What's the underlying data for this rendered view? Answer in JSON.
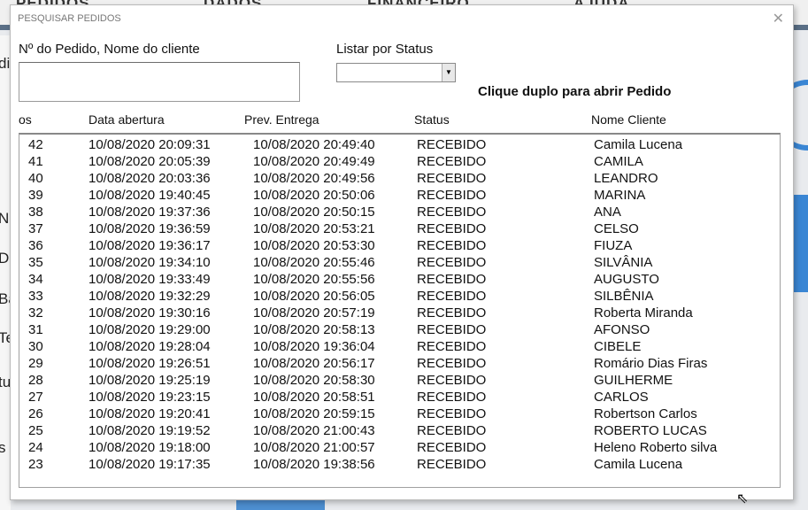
{
  "background": {
    "menu": [
      "PEDIDOS",
      "DADOS",
      "FINANCEIRO",
      "AJUDA"
    ],
    "left_fragments": [
      "di",
      "N",
      "D",
      "Ba",
      "Te",
      "tu",
      "s"
    ]
  },
  "dialog": {
    "title": "PESQUISAR PEDIDOS",
    "close": "✕",
    "search_label": "Nº do Pedido, Nome do cliente",
    "search_value": "",
    "status_label": "Listar por Status",
    "status_value": "",
    "hint": "Clique duplo para abrir Pedido",
    "columns": [
      "os",
      "Data abertura",
      "Prev. Entrega",
      "Status",
      "Nome Cliente"
    ],
    "rows": [
      [
        "42",
        "10/08/2020 20:09:31",
        "10/08/2020 20:49:40",
        "RECEBIDO",
        "Camila Lucena"
      ],
      [
        "41",
        "10/08/2020 20:05:39",
        "10/08/2020 20:49:49",
        "RECEBIDO",
        "CAMILA"
      ],
      [
        "40",
        "10/08/2020 20:03:36",
        "10/08/2020 20:49:56",
        "RECEBIDO",
        "LEANDRO"
      ],
      [
        "39",
        "10/08/2020 19:40:45",
        "10/08/2020 20:50:06",
        "RECEBIDO",
        "MARINA"
      ],
      [
        "38",
        "10/08/2020 19:37:36",
        "10/08/2020 20:50:15",
        "RECEBIDO",
        "ANA"
      ],
      [
        "37",
        "10/08/2020 19:36:59",
        "10/08/2020 20:53:21",
        "RECEBIDO",
        "CELSO"
      ],
      [
        "36",
        "10/08/2020 19:36:17",
        "10/08/2020 20:53:30",
        "RECEBIDO",
        "FIUZA"
      ],
      [
        "35",
        "10/08/2020 19:34:10",
        "10/08/2020 20:55:46",
        "RECEBIDO",
        "SILVÂNIA"
      ],
      [
        "34",
        "10/08/2020 19:33:49",
        "10/08/2020 20:55:56",
        "RECEBIDO",
        "AUGUSTO"
      ],
      [
        "33",
        "10/08/2020 19:32:29",
        "10/08/2020 20:56:05",
        "RECEBIDO",
        "SILBÊNIA"
      ],
      [
        "32",
        "10/08/2020 19:30:16",
        "10/08/2020 20:57:19",
        "RECEBIDO",
        "Roberta Miranda"
      ],
      [
        "31",
        "10/08/2020 19:29:00",
        "10/08/2020 20:58:13",
        "RECEBIDO",
        "AFONSO"
      ],
      [
        "30",
        "10/08/2020 19:28:04",
        "10/08/2020 19:36:04",
        "RECEBIDO",
        "CIBELE"
      ],
      [
        "29",
        "10/08/2020 19:26:51",
        "10/08/2020 20:56:17",
        "RECEBIDO",
        "Romário Dias Firas"
      ],
      [
        "28",
        "10/08/2020 19:25:19",
        "10/08/2020 20:58:30",
        "RECEBIDO",
        "GUILHERME"
      ],
      [
        "27",
        "10/08/2020 19:23:15",
        "10/08/2020 20:58:51",
        "RECEBIDO",
        "CARLOS"
      ],
      [
        "26",
        "10/08/2020 19:20:41",
        "10/08/2020 20:59:15",
        "RECEBIDO",
        "Robertson Carlos"
      ],
      [
        "25",
        "10/08/2020 19:19:52",
        "10/08/2020 21:00:43",
        "RECEBIDO",
        "ROBERTO LUCAS"
      ],
      [
        "24",
        "10/08/2020 19:18:00",
        "10/08/2020 21:00:57",
        "RECEBIDO",
        "Heleno Roberto silva"
      ],
      [
        "23",
        "10/08/2020 19:17:35",
        "10/08/2020 19:38:56",
        "RECEBIDO",
        "Camila Lucena"
      ]
    ]
  }
}
